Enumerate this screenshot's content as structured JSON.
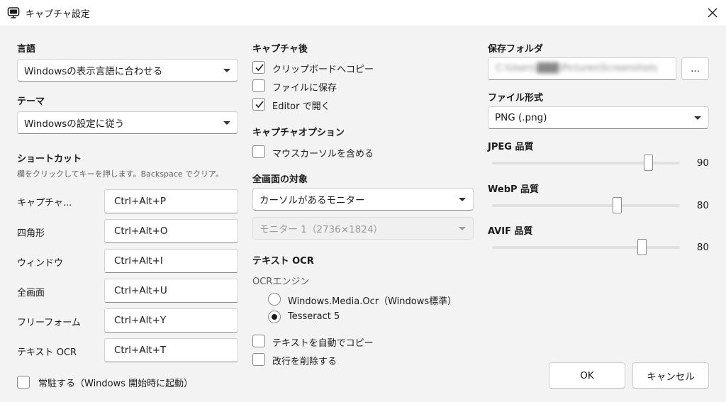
{
  "window": {
    "title": "キャプチャ設定",
    "icon": "app-monitor-icon"
  },
  "left": {
    "language_label": "言語",
    "language_value": "Windowsの表示言語に合わせる",
    "theme_label": "テーマ",
    "theme_value": "Windowsの設定に従う",
    "shortcut_label": "ショートカット",
    "shortcut_hint": "欄をクリックしてキーを押します。Backspace でクリア。",
    "shortcuts": [
      {
        "name": "キャプチャ...",
        "keys": "Ctrl+Alt+P"
      },
      {
        "name": "四角形",
        "keys": "Ctrl+Alt+O"
      },
      {
        "name": "ウィンドウ",
        "keys": "Ctrl+Alt+I"
      },
      {
        "name": "全画面",
        "keys": "Ctrl+Alt+U"
      },
      {
        "name": "フリーフォーム",
        "keys": "Ctrl+Alt+Y"
      },
      {
        "name": "テキスト OCR",
        "keys": "Ctrl+Alt+T"
      }
    ],
    "resident_label": "常駐する（Windows 開始時に起動）",
    "resident_checked": false
  },
  "middle": {
    "after_capture_label": "キャプチャ後",
    "after_options": [
      {
        "label": "クリップボードへコピー",
        "checked": true
      },
      {
        "label": "ファイルに保存",
        "checked": false
      },
      {
        "label": "Editor で開く",
        "checked": true
      }
    ],
    "capture_options_label": "キャプチャオプション",
    "include_cursor_label": "マウスカーソルを含める",
    "include_cursor_checked": false,
    "fullscreen_target_label": "全画面の対象",
    "fullscreen_target_value": "カーソルがあるモニター",
    "monitor_value": "モニター 1（2736×1824）",
    "ocr_label": "テキスト OCR",
    "ocr_engine_label": "OCRエンジン",
    "ocr_engines": [
      {
        "label": "Windows.Media.Ocr（Windows標準）",
        "checked": false
      },
      {
        "label": "Tesseract 5",
        "checked": true
      }
    ],
    "auto_copy_label": "テキストを自動でコピー",
    "auto_copy_checked": false,
    "remove_newlines_label": "改行を削除する",
    "remove_newlines_checked": false
  },
  "right": {
    "save_folder_label": "保存フォルダ",
    "save_folder_value": "C:\\Users\\███\\Pictures\\Screenshots",
    "browse_label": "...",
    "file_format_label": "ファイル形式",
    "file_format_value": "PNG (.png)",
    "qualities": [
      {
        "label": "JPEG 品質",
        "value": "90",
        "fraction": 0.9
      },
      {
        "label": "WebP 品質",
        "value": "80",
        "fraction": 0.8
      },
      {
        "label": "AVIF 品質",
        "value": "80",
        "fraction": 0.8
      }
    ],
    "ok_label": "OK",
    "cancel_label": "キャンセル"
  },
  "colors": {
    "background": "#f3f3f3",
    "titlebar": "#ffffff",
    "border": "#d0d0d0"
  }
}
